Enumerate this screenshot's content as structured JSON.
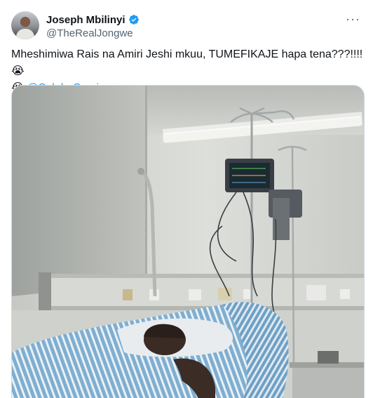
{
  "author": {
    "display_name": "Joseph Mbilinyi",
    "handle": "@TheRealJongwe",
    "verified_icon": "verified-badge-icon",
    "avatar_icon": "avatar"
  },
  "menu_icon": "more-options-icon",
  "tweet": {
    "text_line": "Mheshimiwa Rais na Amiri Jeshi mkuu, TUMEFIKAJE hapa tena???!!!!",
    "emoji_1": "😭",
    "emoji_2": "😭",
    "mention": "@SuluhuSamia"
  },
  "colors": {
    "accent": "#1d9bf0",
    "secondary_text": "#536471",
    "border": "#cfd9de"
  },
  "media": {
    "icon": "photo"
  }
}
